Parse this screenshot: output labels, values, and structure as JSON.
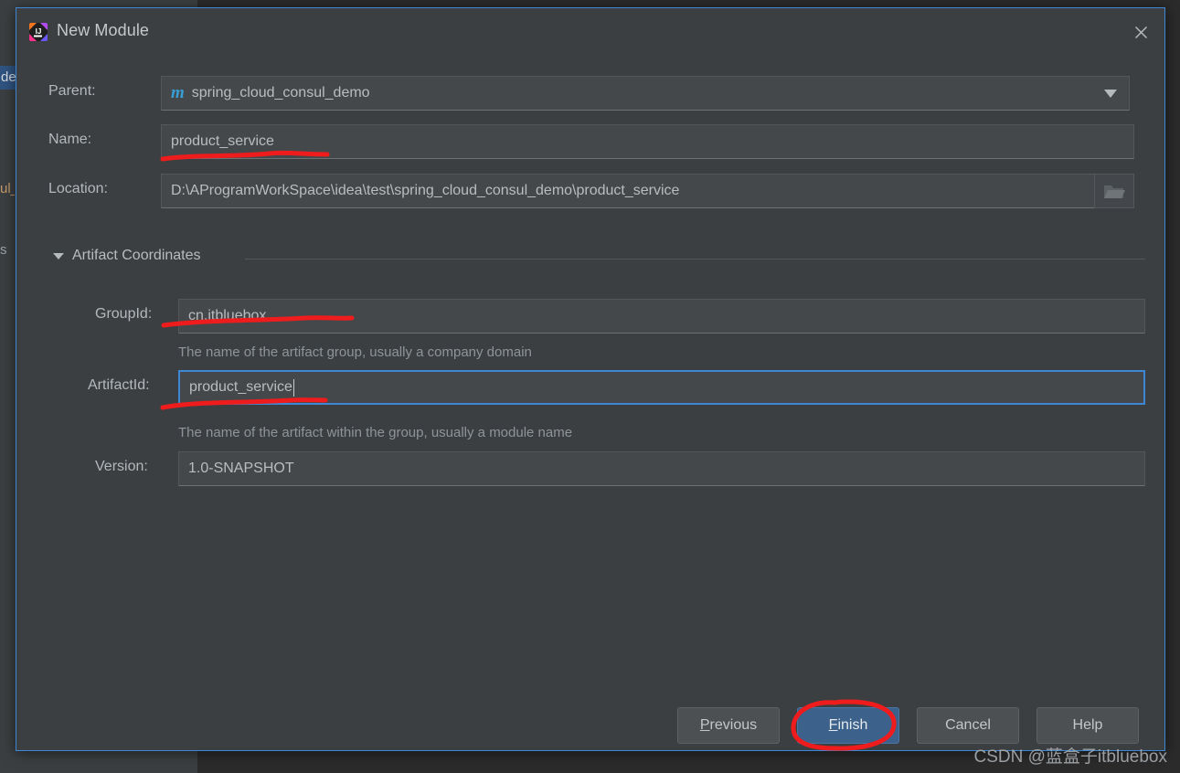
{
  "backdrop": {
    "tree_selected_fragment": "de",
    "tree_fragment_2": "ul_",
    "tree_fragment_3": "s"
  },
  "dialog": {
    "title": "New Module",
    "app_icon": "intellij-idea-icon",
    "close_icon": "close-icon",
    "fields": {
      "parent": {
        "label": "Parent:",
        "value": "spring_cloud_consul_demo",
        "icon": "maven-module-icon",
        "icon_glyph": "m",
        "dropdown_icon": "chevron-down-icon"
      },
      "name": {
        "label": "Name:",
        "value": "product_service"
      },
      "location": {
        "label": "Location:",
        "value": "D:\\AProgramWorkSpace\\idea\\test\\spring_cloud_consul_demo\\product_service",
        "browse_icon": "folder-icon"
      }
    },
    "artifact_section": {
      "title": "Artifact Coordinates",
      "expanded": true,
      "toggle_icon": "triangle-down-icon",
      "group_id": {
        "label": "GroupId:",
        "value": "cn.itbluebox",
        "hint": "The name of the artifact group, usually a company domain"
      },
      "artifact_id": {
        "label": "ArtifactId:",
        "value": "product_service",
        "hint": "The name of the artifact within the group, usually a module name",
        "focused": true
      },
      "version": {
        "label": "Version:",
        "value": "1.0-SNAPSHOT"
      }
    },
    "buttons": [
      {
        "name": "previous-button",
        "label": "Previous",
        "mnemonic": "P",
        "rest": "revious",
        "default": false
      },
      {
        "name": "finish-button",
        "label": "Finish",
        "mnemonic": "F",
        "rest": "inish",
        "default": true
      },
      {
        "name": "cancel-button",
        "label": "Cancel",
        "mnemonic": "",
        "rest": "Cancel",
        "default": false
      },
      {
        "name": "help-button",
        "label": "Help",
        "mnemonic": "",
        "rest": "Help",
        "default": false
      }
    ]
  },
  "annotations": {
    "underline_name": "red-underline-name",
    "underline_groupid": "red-underline-groupid",
    "underline_artifactid": "red-underline-artifactid",
    "circle_finish": "red-circle-finish"
  },
  "watermark": {
    "text": "CSDN @蓝盒子itbluebox"
  },
  "colors": {
    "dialog_bg": "#3c3f41",
    "field_bg": "#45484a",
    "accent_blue": "#3d87d4",
    "default_button": "#3c618a",
    "annotation_red": "#ee1c1c",
    "maven_icon": "#389fd6"
  }
}
